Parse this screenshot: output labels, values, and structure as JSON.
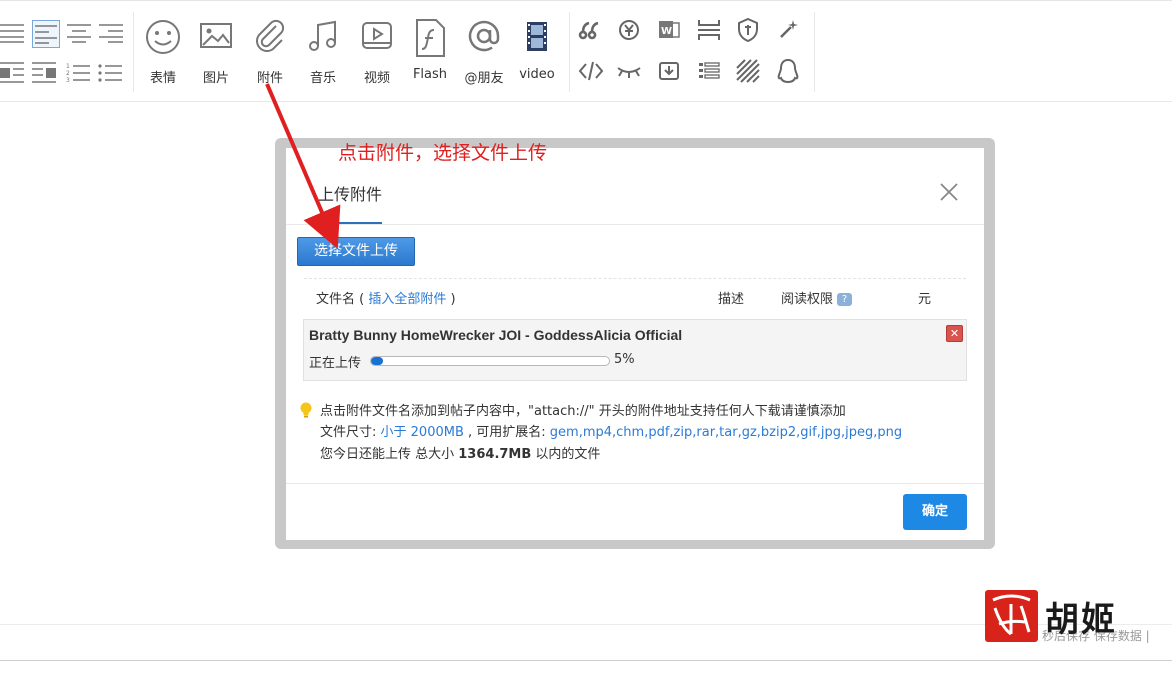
{
  "toolbar": {
    "items": [
      {
        "label": "表情",
        "icon": "emoji-icon"
      },
      {
        "label": "图片",
        "icon": "image-icon"
      },
      {
        "label": "附件",
        "icon": "paperclip-icon"
      },
      {
        "label": "音乐",
        "icon": "music-icon"
      },
      {
        "label": "视频",
        "icon": "video-icon"
      },
      {
        "label": "Flash",
        "icon": "flash-icon"
      },
      {
        "label": "@朋友",
        "icon": "at-icon"
      },
      {
        "label": "video",
        "icon": "film-icon"
      }
    ]
  },
  "annotation": {
    "text": "点击附件，选择文件上传",
    "color": "#e02020"
  },
  "dialog": {
    "title": "上传附件",
    "upload_button": "选择文件上传",
    "columns": {
      "filename": "文件名",
      "paren_open": "(",
      "insert_all": "插入全部附件",
      "paren_close": ")",
      "description": "描述",
      "read_permission": "阅读权限",
      "help_badge": "?",
      "price": "元"
    },
    "files": [
      {
        "name": "Bratty Bunny HomeWrecker JOI - GoddessAlicia Official",
        "status": "正在上传",
        "progress": 5,
        "progress_label": "5%"
      }
    ],
    "tips": {
      "line1": "点击附件文件名添加到帖子内容中，\"attach://\" 开头的附件地址支持任何人下载请谨慎添加",
      "line2_prefix": "文件尺寸: ",
      "line2_size": "小于 2000MB",
      "line2_mid": " , 可用扩展名: ",
      "line2_exts": "gem,mp4,chm,pdf,zip,rar,tar,gz,bzip2,gif,jpg,jpeg,png",
      "line3_prefix": "您今日还能上传 总大小 ",
      "line3_size": "1364.7MB",
      "line3_suffix": " 以内的文件"
    },
    "confirm_button": "确定"
  },
  "footer": {
    "status": "秒后保存 保存数据 |"
  },
  "watermark": {
    "text": "胡姬"
  },
  "colors": {
    "accent": "#1e88e5",
    "link": "#2a7bd6",
    "annotation": "#e02020"
  }
}
